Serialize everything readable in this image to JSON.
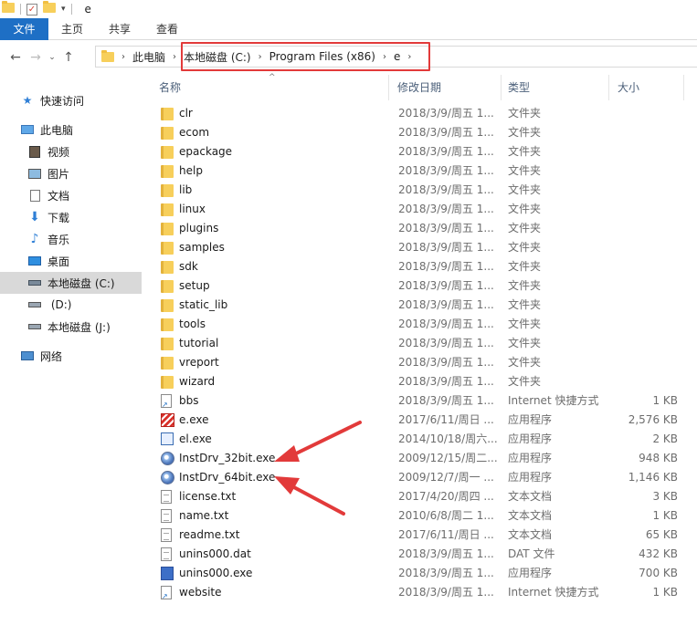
{
  "window": {
    "title": "e"
  },
  "ribbon": {
    "tabs": [
      "文件",
      "主页",
      "共享",
      "查看"
    ]
  },
  "address": {
    "crumbs": [
      "此电脑",
      "本地磁盘 (C:)",
      "Program Files (x86)",
      "e"
    ]
  },
  "sidebar": {
    "items": [
      {
        "label": "快速访问",
        "icon": "star-icon"
      },
      {
        "label": "此电脑",
        "icon": "computer-icon"
      },
      {
        "label": "视频",
        "icon": "video-icon"
      },
      {
        "label": "图片",
        "icon": "picture-icon"
      },
      {
        "label": "文档",
        "icon": "document-icon"
      },
      {
        "label": "下载",
        "icon": "download-icon"
      },
      {
        "label": "音乐",
        "icon": "music-icon"
      },
      {
        "label": "桌面",
        "icon": "desktop-icon"
      },
      {
        "label": "本地磁盘 (C:)",
        "icon": "drive-icon"
      },
      {
        "label": " (D:)",
        "icon": "drive-icon"
      },
      {
        "label": "本地磁盘 (J:)",
        "icon": "drive-icon"
      },
      {
        "label": "网络",
        "icon": "network-icon"
      }
    ]
  },
  "columns": {
    "name": "名称",
    "date": "修改日期",
    "type": "类型",
    "size": "大小"
  },
  "files": [
    {
      "name": "clr",
      "date": "2018/3/9/周五 1...",
      "type": "文件夹",
      "size": "",
      "icon": "folder-icon"
    },
    {
      "name": "ecom",
      "date": "2018/3/9/周五 1...",
      "type": "文件夹",
      "size": "",
      "icon": "folder-icon"
    },
    {
      "name": "epackage",
      "date": "2018/3/9/周五 1...",
      "type": "文件夹",
      "size": "",
      "icon": "folder-icon"
    },
    {
      "name": "help",
      "date": "2018/3/9/周五 1...",
      "type": "文件夹",
      "size": "",
      "icon": "folder-icon"
    },
    {
      "name": "lib",
      "date": "2018/3/9/周五 1...",
      "type": "文件夹",
      "size": "",
      "icon": "folder-icon"
    },
    {
      "name": "linux",
      "date": "2018/3/9/周五 1...",
      "type": "文件夹",
      "size": "",
      "icon": "folder-icon"
    },
    {
      "name": "plugins",
      "date": "2018/3/9/周五 1...",
      "type": "文件夹",
      "size": "",
      "icon": "folder-icon"
    },
    {
      "name": "samples",
      "date": "2018/3/9/周五 1...",
      "type": "文件夹",
      "size": "",
      "icon": "folder-icon"
    },
    {
      "name": "sdk",
      "date": "2018/3/9/周五 1...",
      "type": "文件夹",
      "size": "",
      "icon": "folder-icon"
    },
    {
      "name": "setup",
      "date": "2018/3/9/周五 1...",
      "type": "文件夹",
      "size": "",
      "icon": "folder-icon"
    },
    {
      "name": "static_lib",
      "date": "2018/3/9/周五 1...",
      "type": "文件夹",
      "size": "",
      "icon": "folder-icon"
    },
    {
      "name": "tools",
      "date": "2018/3/9/周五 1...",
      "type": "文件夹",
      "size": "",
      "icon": "folder-icon"
    },
    {
      "name": "tutorial",
      "date": "2018/3/9/周五 1...",
      "type": "文件夹",
      "size": "",
      "icon": "folder-icon"
    },
    {
      "name": "vreport",
      "date": "2018/3/9/周五 1...",
      "type": "文件夹",
      "size": "",
      "icon": "folder-icon"
    },
    {
      "name": "wizard",
      "date": "2018/3/9/周五 1...",
      "type": "文件夹",
      "size": "",
      "icon": "folder-icon"
    },
    {
      "name": "bbs",
      "date": "2018/3/9/周五 1...",
      "type": "Internet 快捷方式",
      "size": "1 KB",
      "icon": "shortcut-icon"
    },
    {
      "name": "e.exe",
      "date": "2017/6/11/周日 ...",
      "type": "应用程序",
      "size": "2,576 KB",
      "icon": "e-app-icon"
    },
    {
      "name": "el.exe",
      "date": "2014/10/18/周六...",
      "type": "应用程序",
      "size": "2 KB",
      "icon": "app-icon"
    },
    {
      "name": "InstDrv_32bit.exe",
      "date": "2009/12/15/周二...",
      "type": "应用程序",
      "size": "948 KB",
      "icon": "installer-icon"
    },
    {
      "name": "InstDrv_64bit.exe",
      "date": "2009/12/7/周一 ...",
      "type": "应用程序",
      "size": "1,146 KB",
      "icon": "installer-icon"
    },
    {
      "name": "license.txt",
      "date": "2017/4/20/周四 ...",
      "type": "文本文档",
      "size": "3 KB",
      "icon": "text-file-icon"
    },
    {
      "name": "name.txt",
      "date": "2010/6/8/周二 1...",
      "type": "文本文档",
      "size": "1 KB",
      "icon": "text-file-icon"
    },
    {
      "name": "readme.txt",
      "date": "2017/6/11/周日 ...",
      "type": "文本文档",
      "size": "65 KB",
      "icon": "text-file-icon"
    },
    {
      "name": "unins000.dat",
      "date": "2018/3/9/周五 1...",
      "type": "DAT 文件",
      "size": "432 KB",
      "icon": "file-icon"
    },
    {
      "name": "unins000.exe",
      "date": "2018/3/9/周五 1...",
      "type": "应用程序",
      "size": "700 KB",
      "icon": "uninstaller-icon"
    },
    {
      "name": "website",
      "date": "2018/3/9/周五 1...",
      "type": "Internet 快捷方式",
      "size": "1 KB",
      "icon": "shortcut-icon"
    }
  ],
  "highlight_color": "#e23a3a",
  "accent_color": "#1e6fc5"
}
